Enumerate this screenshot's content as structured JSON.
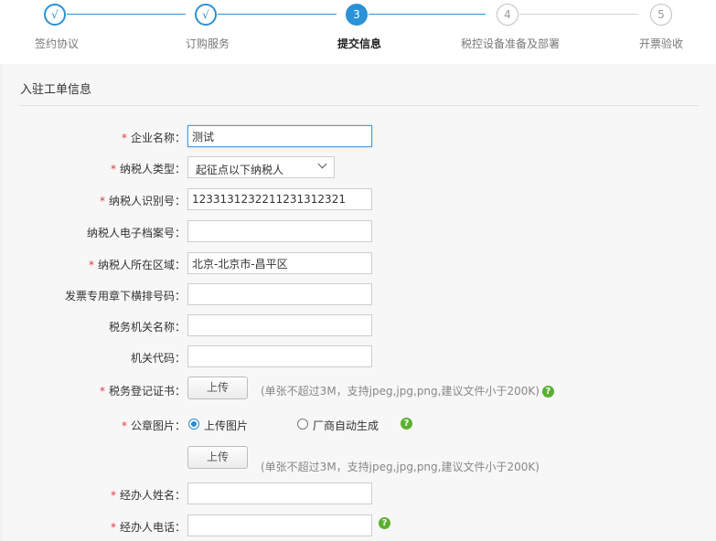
{
  "steps": [
    {
      "number": "√",
      "label": "签约协议",
      "state": "done"
    },
    {
      "number": "√",
      "label": "订购服务",
      "state": "done"
    },
    {
      "number": "3",
      "label": "提交信息",
      "state": "active"
    },
    {
      "number": "4",
      "label": "税控设备准备及部署",
      "state": "pending"
    },
    {
      "number": "5",
      "label": "开票验收",
      "state": "pending"
    }
  ],
  "colors": {
    "accent": "#2a92d6",
    "required": "#e23b3b",
    "help": "#5bb030"
  },
  "form": {
    "title": "入驻工单信息",
    "required_mark": "*",
    "company_name": {
      "label": "企业名称：",
      "value": "测试"
    },
    "taxpayer_type": {
      "label": "纳税人类型：",
      "value": "起征点以下纳税人"
    },
    "taxpayer_id": {
      "label": "纳税人识别号：",
      "value": "123313123221123131232​1"
    },
    "e_archive_no": {
      "label": "纳税人电子档案号：",
      "value": ""
    },
    "region": {
      "label": "纳税人所在区域：",
      "value": "北京-北京市-昌平区"
    },
    "invoice_seal_no": {
      "label": "发票专用章下横排号码：",
      "value": ""
    },
    "tax_office": {
      "label": "税务机关名称：",
      "value": ""
    },
    "office_code": {
      "label": "机关代码：",
      "value": ""
    },
    "tax_cert": {
      "label": "税务登记证书：",
      "button": "上传",
      "hint": "(单张不超过3M，支持jpeg,jpg,png,建议文件小于200K)"
    },
    "seal_image": {
      "label": "公章图片：",
      "option_upload": "上传图片",
      "option_auto": "厂商自动生成",
      "button": "上传",
      "hint": "(单张不超过3M，支持jpeg,jpg,png,建议文件小于200K)"
    },
    "agent_name": {
      "label": "经办人姓名：",
      "value": ""
    },
    "agent_phone": {
      "label": "经办人电话：",
      "value": ""
    },
    "help_glyph": "?"
  }
}
